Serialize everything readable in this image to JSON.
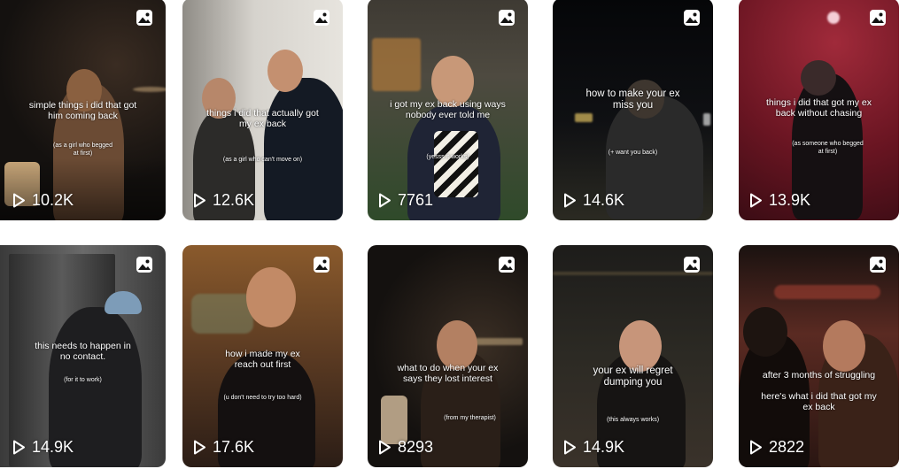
{
  "posts": [
    {
      "caption": "simple things i did that got\nhim coming back",
      "sub": "(as a girl who begged\nat first)",
      "views": "10.2K",
      "bg": "#14110f",
      "accent": "#7a5a3a"
    },
    {
      "caption": "things i did that actually got\nmy ex back",
      "sub": "(as a girl who can't move on)",
      "views": "12.6K",
      "bg": "#c9c6c0",
      "accent": "#2b2a2a"
    },
    {
      "caption": "i got my ex back using ways\nnobody ever told me",
      "sub": "(yesss it works)",
      "views": "7761",
      "bg": "#2c2a24",
      "accent": "#6e5233"
    },
    {
      "caption": "how to make your ex\nmiss you",
      "sub": "(+ want you back)",
      "views": "14.6K",
      "bg": "#0c0d10",
      "accent": "#3a3a3c"
    },
    {
      "caption": "things i did that got my ex\nback without chasing",
      "sub": "(as someone who begged\nat first)",
      "views": "13.9K",
      "bg": "#7a1d2a",
      "accent": "#1c1113"
    },
    {
      "caption": "this needs to happen in\nno contact.",
      "sub": "(for it to work)",
      "views": "14.9K",
      "bg": "#5d5d5d",
      "accent": "#2a2a2a"
    },
    {
      "caption": "how i made my ex\nreach out first",
      "sub": "(u don't need to try too hard)",
      "views": "17.6K",
      "bg": "#6e4a2a",
      "accent": "#1b1412"
    },
    {
      "caption": "what to do when your ex\nsays they lost interest",
      "sub": "(from my therapist)",
      "views": "8293",
      "bg": "#1a1714",
      "accent": "#7b5a3e"
    },
    {
      "caption": "your ex will regret\ndumping you",
      "sub": "(this always works)",
      "views": "14.9K",
      "bg": "#1f1d1a",
      "accent": "#8a6a55"
    },
    {
      "caption": "after 3 months of struggling\n\nhere's what i did that got my\nex back",
      "sub": "",
      "views": "2822",
      "bg": "#2a1a16",
      "accent": "#c44a3a"
    }
  ],
  "icons": {
    "photo": "photo-carousel-icon",
    "play": "play-icon"
  }
}
